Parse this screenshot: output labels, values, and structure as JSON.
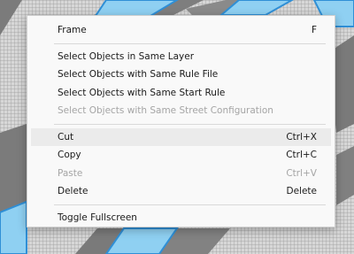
{
  "context_menu": {
    "frame": {
      "label": "Frame",
      "shortcut": "F"
    },
    "select_same_layer": {
      "label": "Select Objects in Same Layer"
    },
    "select_same_rule_file": {
      "label": "Select Objects with Same Rule File"
    },
    "select_same_start_rule": {
      "label": "Select Objects with Same Start Rule"
    },
    "select_same_street_config": {
      "label": "Select Objects with Same Street Configuration",
      "disabled": true
    },
    "cut": {
      "label": "Cut",
      "shortcut": "Ctrl+X",
      "highlighted": true
    },
    "copy": {
      "label": "Copy",
      "shortcut": "Ctrl+C"
    },
    "paste": {
      "label": "Paste",
      "shortcut": "Ctrl+V",
      "disabled": true
    },
    "delete": {
      "label": "Delete",
      "shortcut": "Delete"
    },
    "toggle_fullscreen": {
      "label": "Toggle Fullscreen"
    }
  },
  "colors": {
    "selection_blue": "#8fd0f2",
    "selection_edge": "#2f8fd6",
    "street_dark": "#7b7b7b"
  }
}
